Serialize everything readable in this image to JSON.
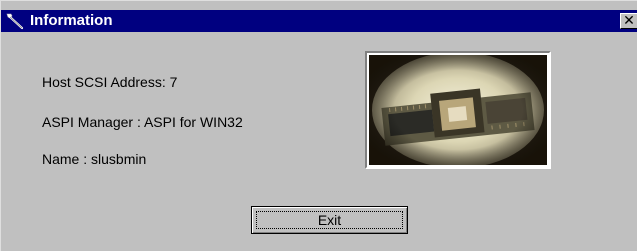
{
  "window": {
    "title": "Information",
    "title_bar_color": "#000080",
    "background_color": "#c0c0c0"
  },
  "info": {
    "host_scsi_address": "Host SCSI Address: 7",
    "aspi_manager": "ASPI Manager : ASPI for WIN32",
    "name": "Name : slusbmin"
  },
  "buttons": {
    "exit_label": "Exit",
    "close_glyph": "✕"
  },
  "icons": {
    "app_icon": "wrench-icon",
    "close_icon": "close-icon"
  }
}
